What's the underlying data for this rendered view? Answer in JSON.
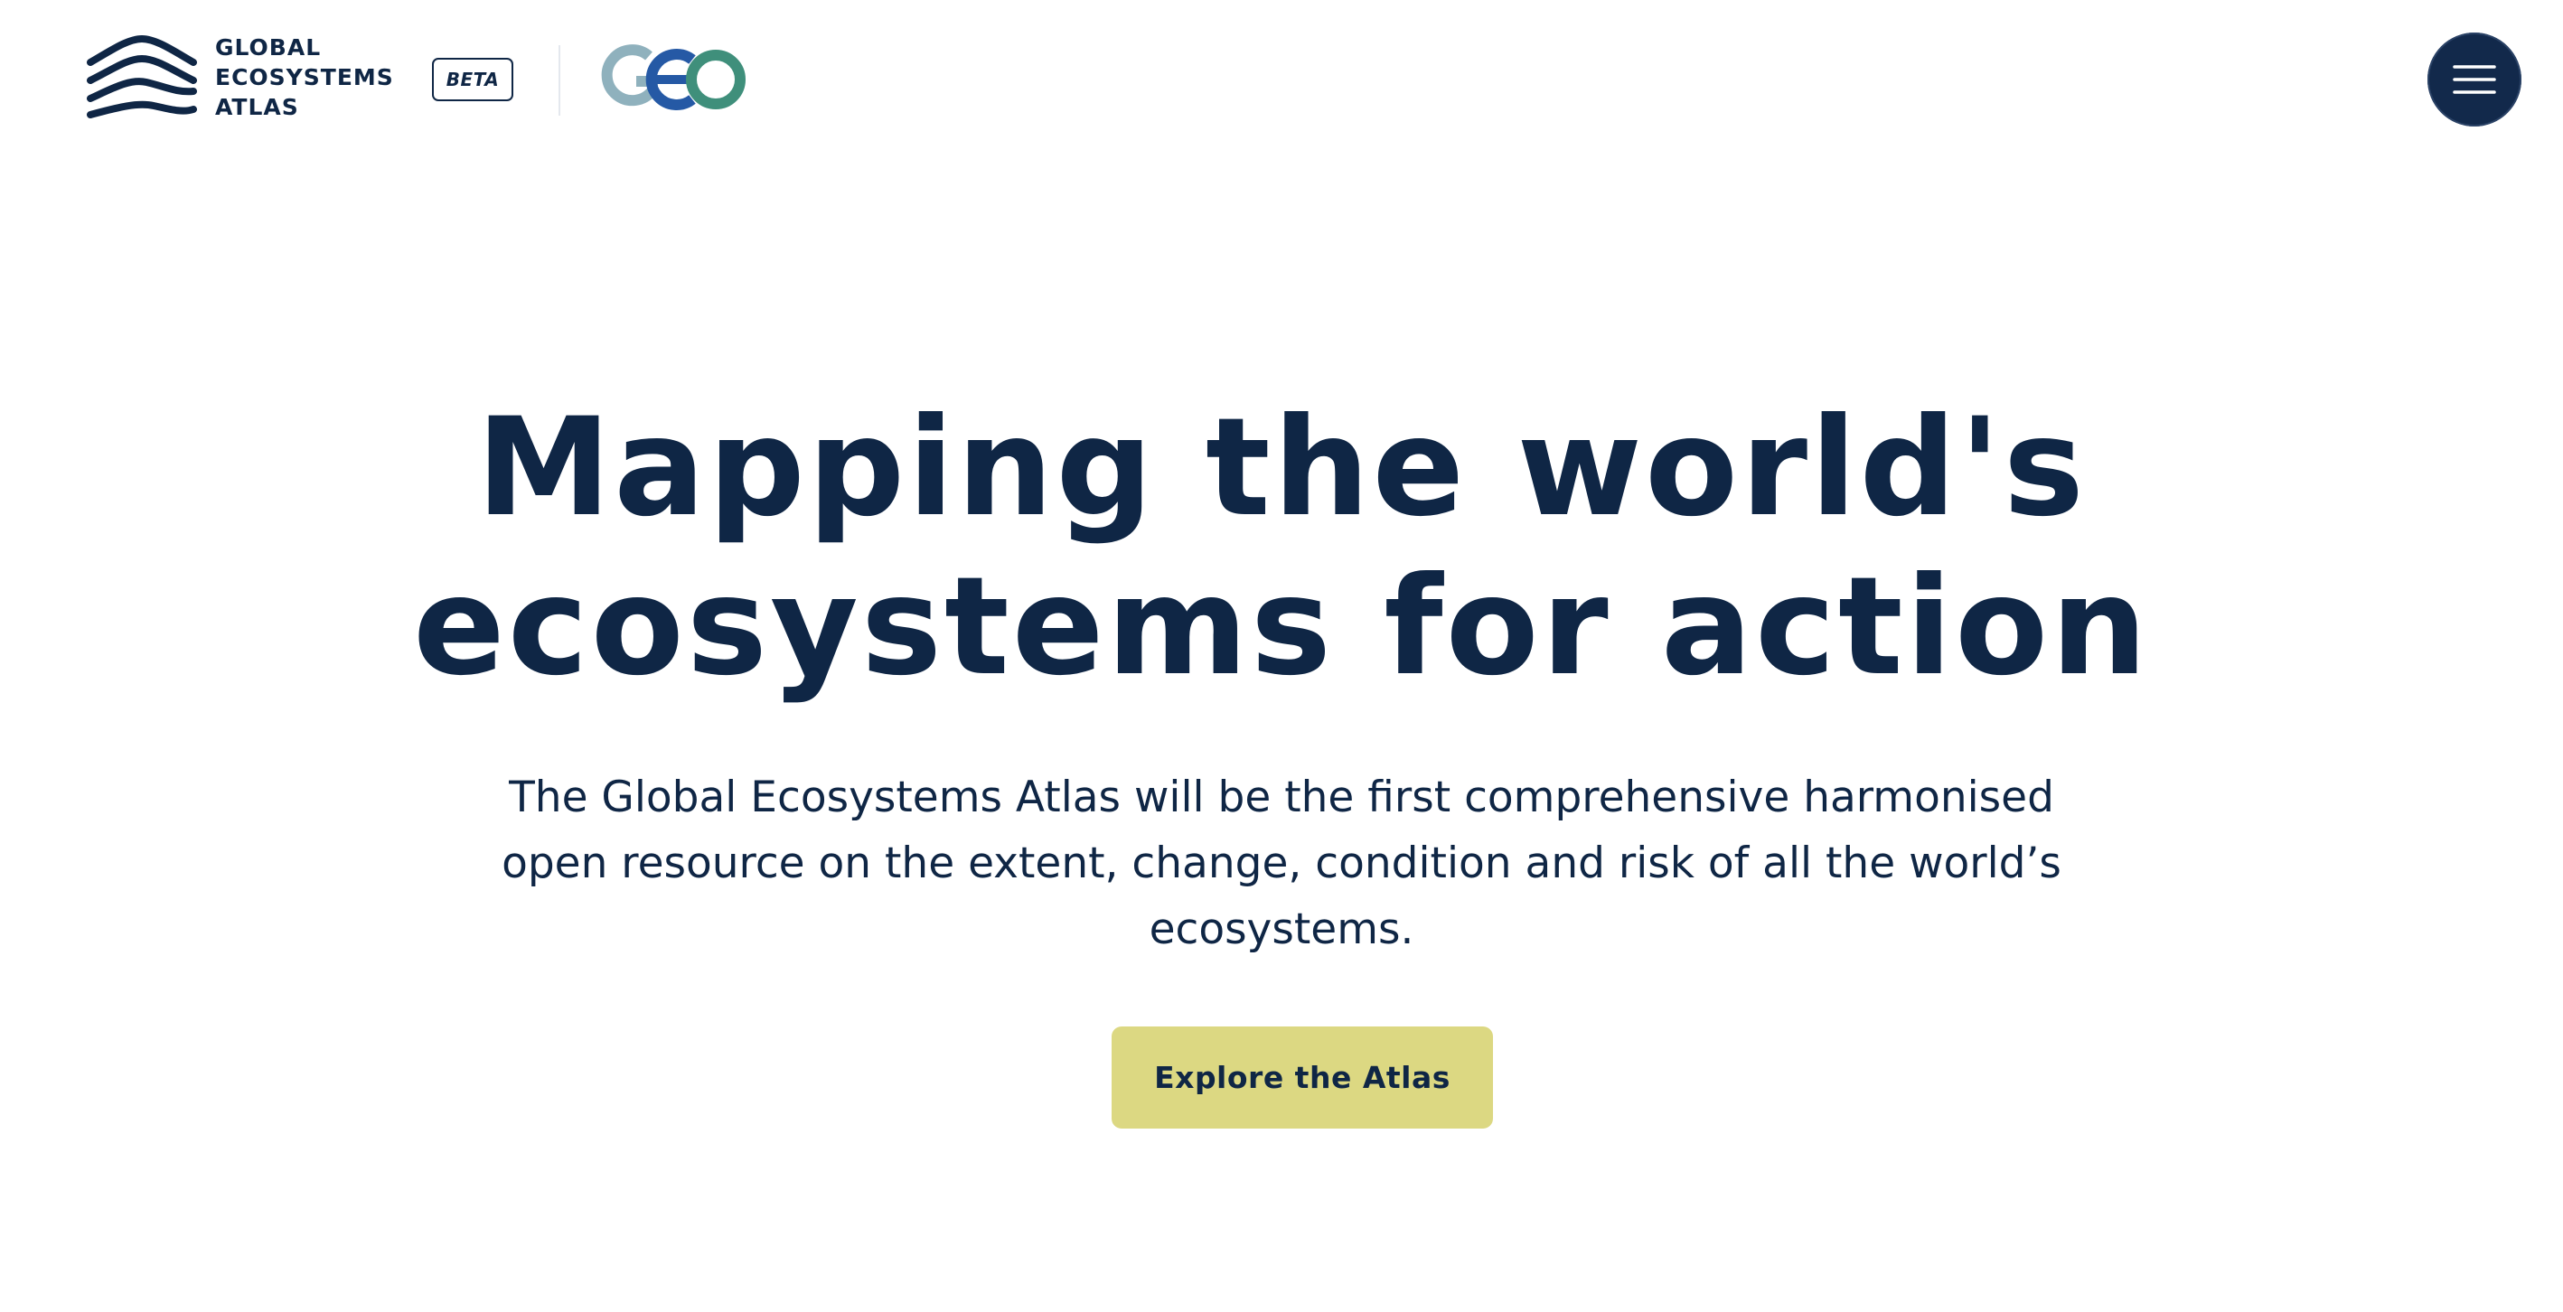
{
  "header": {
    "brand": {
      "line1": "GLOBAL",
      "line2": "ECOSYSTEMS",
      "line3": "ATLAS",
      "logo_icon": "waves-icon"
    },
    "badge": "BETA",
    "partner_logo": {
      "name": "geo-logo",
      "letters": "GEO"
    },
    "menu_icon": "hamburger-icon"
  },
  "hero": {
    "title_line1": "Mapping the world's",
    "title_line2": "ecosystems for action",
    "description": "The Global Ecosystems Atlas will be the first comprehensive harmonised open resource on the extent, change, condition and risk of all the world’s ecosystems.",
    "cta_label": "Explore the Atlas"
  },
  "colors": {
    "navy": "#0f2645",
    "cta_background": "#dcd882",
    "geo_gray": "#8fb1bd",
    "geo_blue": "#2559a5",
    "geo_green": "#3f8f7b",
    "background": "#ffffff"
  }
}
